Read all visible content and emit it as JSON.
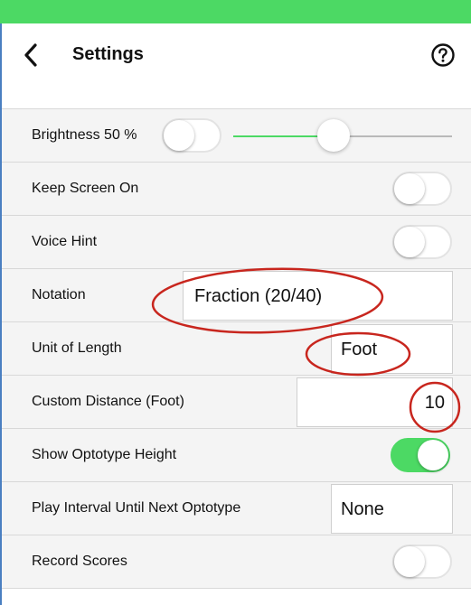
{
  "header": {
    "title": "Settings",
    "back_icon": "chevron-left-icon",
    "help_icon": "question-circle-icon"
  },
  "colors": {
    "accent": "#4cd964",
    "annotation": "#c8261e"
  },
  "settings": {
    "brightness": {
      "label": "Brightness 50 %",
      "toggle_on": false,
      "slider_fraction": 0.46
    },
    "keep_screen_on": {
      "label": "Keep Screen On",
      "toggle_on": false
    },
    "voice_hint": {
      "label": "Voice Hint",
      "toggle_on": false
    },
    "notation": {
      "label": "Notation",
      "value": "Fraction (20/40)"
    },
    "unit_of_length": {
      "label": "Unit of Length",
      "value": "Foot"
    },
    "custom_distance": {
      "label": "Custom Distance (Foot)",
      "value": "10"
    },
    "show_optotype_height": {
      "label": "Show Optotype Height",
      "toggle_on": true
    },
    "play_interval": {
      "label": "Play Interval Until Next Optotype",
      "value": "None"
    },
    "record_scores": {
      "label": "Record Scores",
      "toggle_on": false
    }
  }
}
